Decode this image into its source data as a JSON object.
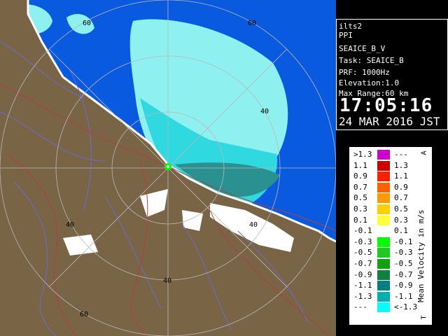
{
  "radar_info": {
    "station": "ilts2",
    "product": "PPI",
    "mode": "SEAICE_B_V",
    "task": "Task: SEAICE_B",
    "prf": "PRF: 1000Hz",
    "elevation": "Elevation:1.0",
    "max_range": "Max Range:60 km",
    "time": "17:05:16",
    "date": "24 MAR 2016 JST"
  },
  "range_ring_labels": [
    "60",
    "60",
    "40",
    "40",
    "40",
    "40",
    "60"
  ],
  "legend": {
    "title": "Mean Velocity in m/s",
    "corner_top": "A",
    "corner_bottom": "T",
    "rows": [
      {
        "lo": ">1.3",
        "hi": "---",
        "color": "#cc00cc"
      },
      {
        "lo": "1.1",
        "hi": "1.3",
        "color": "#cc0000"
      },
      {
        "lo": "0.9",
        "hi": "1.1",
        "color": "#ff2000"
      },
      {
        "lo": "0.7",
        "hi": "0.9",
        "color": "#ff6000"
      },
      {
        "lo": "0.5",
        "hi": "0.7",
        "color": "#ff9a00"
      },
      {
        "lo": "0.3",
        "hi": "0.5",
        "color": "#ffd000"
      },
      {
        "lo": "0.1",
        "hi": "0.3",
        "color": "#ffff40"
      },
      {
        "lo": "-0.1",
        "hi": "0.1",
        "color": "#ffffff"
      },
      {
        "lo": "-0.3",
        "hi": "-0.1",
        "color": "#00ff00"
      },
      {
        "lo": "-0.5",
        "hi": "-0.3",
        "color": "#20c820"
      },
      {
        "lo": "-0.7",
        "hi": "-0.5",
        "color": "#10a010"
      },
      {
        "lo": "-0.9",
        "hi": "-0.7",
        "color": "#108040"
      },
      {
        "lo": "-1.1",
        "hi": "-0.9",
        "color": "#008080"
      },
      {
        "lo": "-1.3",
        "hi": "-1.1",
        "color": "#00b0b0"
      },
      {
        "lo": "---",
        "hi": "<-1.3",
        "color": "#00ffff"
      }
    ]
  },
  "colors": {
    "sea": "#0a5ae0",
    "land": "#7a6446",
    "echo_light": "#8ff0f0",
    "echo_mid": "#30d8e0",
    "echo_dark": "#2a9090",
    "coast": "#ffffff",
    "rivers": "#6a6ad0",
    "roads": "#b04040"
  }
}
